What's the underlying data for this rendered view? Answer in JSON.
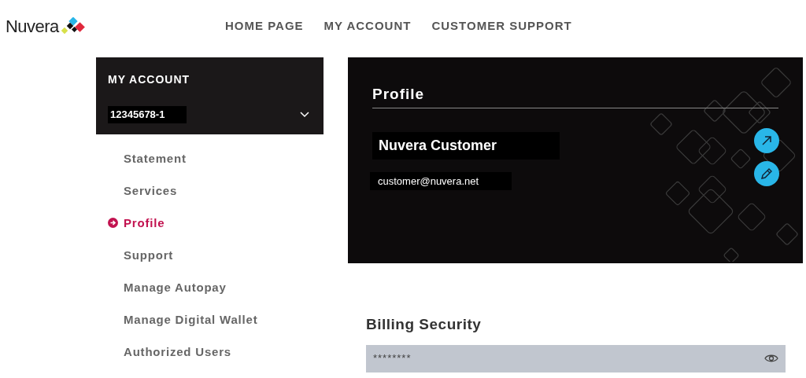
{
  "header": {
    "logo": "Nuvera",
    "nav": [
      {
        "label": "HOME PAGE"
      },
      {
        "label": "MY ACCOUNT"
      },
      {
        "label": "CUSTOMER SUPPORT"
      }
    ]
  },
  "sidebar": {
    "title": "MY ACCOUNT",
    "account_number": "12345678-1",
    "items": [
      {
        "label": "Statement",
        "selected": false
      },
      {
        "label": "Services",
        "selected": false
      },
      {
        "label": "Profile",
        "selected": true
      },
      {
        "label": "Support",
        "selected": false
      },
      {
        "label": "Manage Autopay",
        "selected": false
      },
      {
        "label": "Manage Digital Wallet",
        "selected": false
      },
      {
        "label": "Authorized Users",
        "selected": false
      }
    ]
  },
  "profile": {
    "title": "Profile",
    "name": "Nuvera Customer",
    "email": "customer@nuvera.net"
  },
  "billing_security": {
    "title": "Billing Security",
    "value": "********"
  }
}
